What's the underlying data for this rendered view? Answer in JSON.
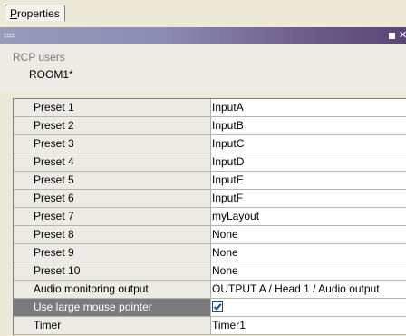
{
  "tab": {
    "label_first": "P",
    "label_rest": "roperties"
  },
  "panel": {
    "rcp_label": "RCP users",
    "room_name": "ROOM1*"
  },
  "properties": [
    {
      "name": "Preset 1",
      "value": "InputA"
    },
    {
      "name": "Preset 2",
      "value": "InputB"
    },
    {
      "name": "Preset 3",
      "value": "InputC"
    },
    {
      "name": "Preset 4",
      "value": "InputD"
    },
    {
      "name": "Preset 5",
      "value": "InputE"
    },
    {
      "name": "Preset 6",
      "value": "InputF"
    },
    {
      "name": "Preset 7",
      "value": "myLayout"
    },
    {
      "name": "Preset 8",
      "value": "None"
    },
    {
      "name": "Preset 9",
      "value": "None"
    },
    {
      "name": "Preset 10",
      "value": "None"
    },
    {
      "name": "Audio monitoring output",
      "value": "OUTPUT A / Head 1 / Audio output"
    },
    {
      "name": "Use large mouse pointer",
      "checked": true
    },
    {
      "name": "Timer",
      "value": "Timer1"
    }
  ],
  "colors": {
    "selected_row": "#7b7b7b",
    "checkbox_border": "#1c5180",
    "titlebar_end": "#5a4576"
  },
  "icons": [
    "grip-icon",
    "restore-icon",
    "close-icon",
    "checkmark-icon"
  ]
}
